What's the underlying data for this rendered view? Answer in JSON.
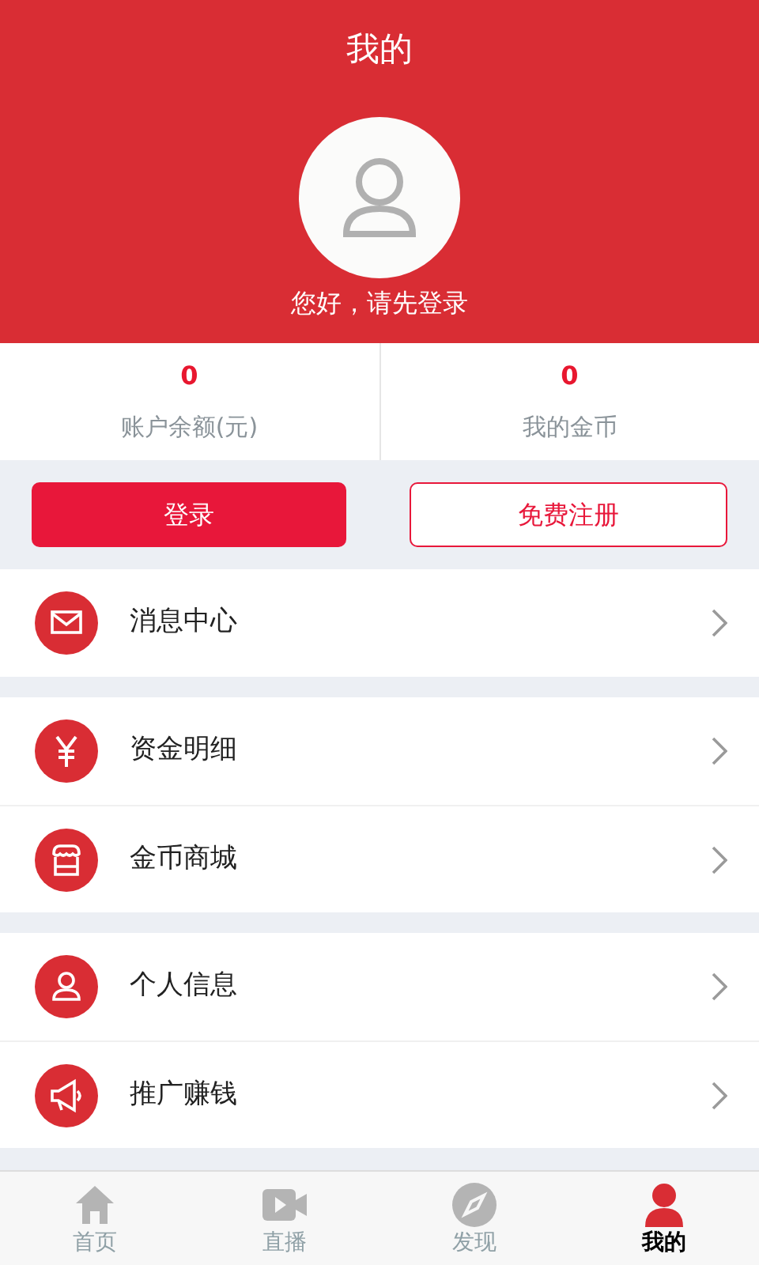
{
  "header": {
    "title": "我的",
    "greeting": "您好，请先登录"
  },
  "stats": [
    {
      "value": "0",
      "label": "账户余额(元)"
    },
    {
      "value": "0",
      "label": "我的金币"
    }
  ],
  "buttons": [
    {
      "label": "登录",
      "kind": "primary"
    },
    {
      "label": "免费注册",
      "kind": "outline"
    }
  ],
  "menu_groups": [
    {
      "items": [
        {
          "label": "消息中心",
          "kind": "mail"
        }
      ]
    },
    {
      "items": [
        {
          "label": "资金明细",
          "kind": "yuan"
        },
        {
          "label": "金币商城",
          "kind": "store"
        }
      ]
    },
    {
      "items": [
        {
          "label": "个人信息",
          "kind": "person"
        },
        {
          "label": "推广赚钱",
          "kind": "megaphone"
        }
      ]
    }
  ],
  "tab_bar": [
    {
      "label": "首页",
      "kind": "home",
      "selected": false
    },
    {
      "label": "直播",
      "kind": "video",
      "selected": false
    },
    {
      "label": "发现",
      "kind": "compass",
      "selected": false
    },
    {
      "label": "我的",
      "kind": "person",
      "selected": true
    }
  ]
}
